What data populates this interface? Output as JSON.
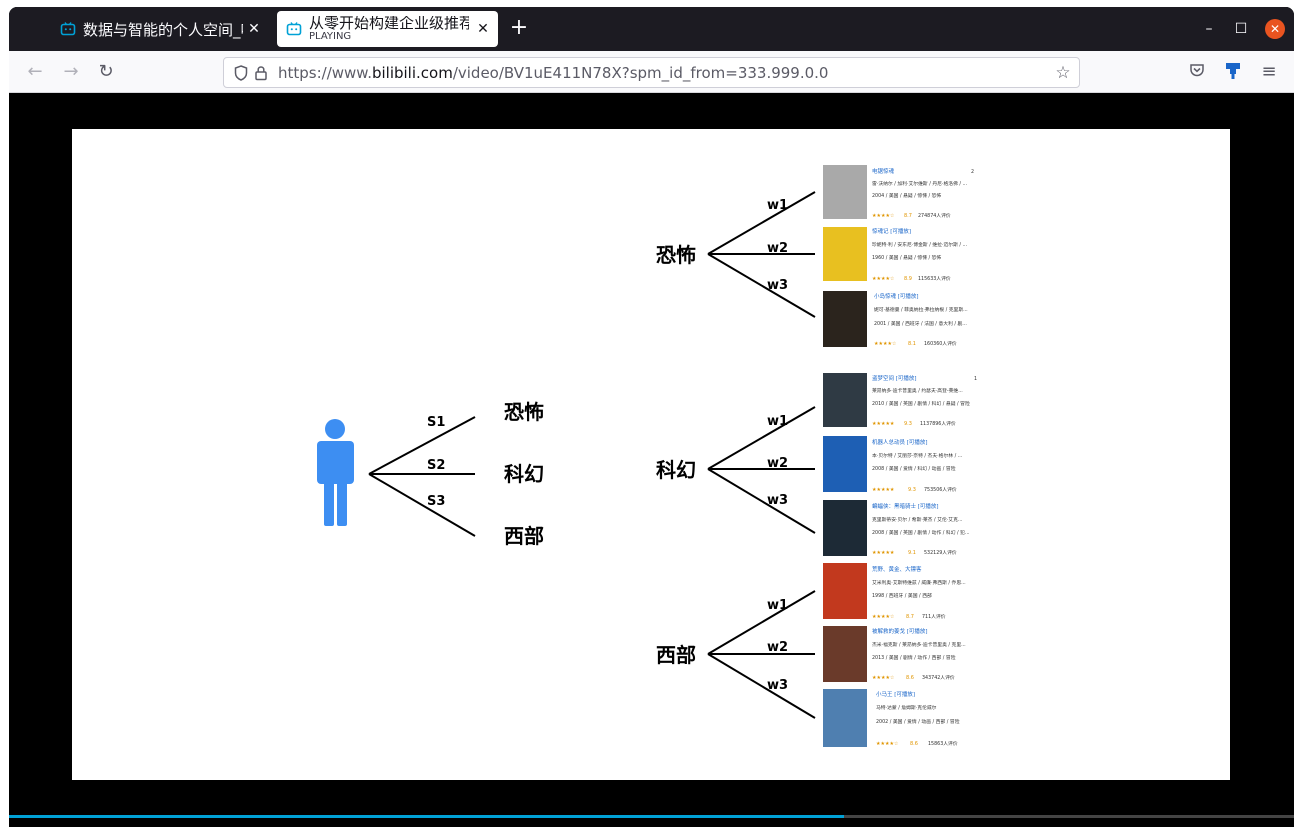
{
  "browser": {
    "tabs": [
      {
        "title": "数据与智能的个人空间_哔",
        "active": false
      },
      {
        "title": "从零开始构建企业级推荐系",
        "subtitle": "PLAYING",
        "active": true
      }
    ],
    "url_prefix": "https://www.",
    "url_host": "bilibili.com",
    "url_path": "/video/BV1uE411N78X?spm_id_from=333.999.0.0",
    "accent": "#00a1d6"
  },
  "player": {
    "progress_fraction": 0.65
  },
  "slide": {
    "left_categories": [
      "恐怖",
      "科幻",
      "西部"
    ],
    "user_weights": [
      "S1",
      "S2",
      "S3"
    ],
    "groups": [
      {
        "category": "恐怖",
        "weights": [
          "w1",
          "w2",
          "w3"
        ],
        "movies": [
          {
            "title": "电锯惊魂",
            "rank": "2",
            "cast": "雷·沃纳尔 / 加利·艾尔维斯 / 丹尼·格洛佛 / ...",
            "info": "2004 / 美国 / 悬疑 / 惊悚 / 恐怖",
            "rating": "8.7",
            "count": "274874人评价",
            "poster": "#a9a9a9"
          },
          {
            "title": "惊魂记 [可播放]",
            "rank": "",
            "cast": "珍妮特·利 / 安东尼·博金斯 / 维拉·迈尔斯 / ...",
            "info": "1960 / 美国 / 悬疑 / 惊悚 / 恐怖",
            "rating": "8.9",
            "count": "115633人评价",
            "poster": "#e8c020"
          },
          {
            "title": "小岛惊魂 [可播放]",
            "rank": "",
            "cast": "妮可·基德曼 / 菲奥纳拉·弗拉纳根 / 克里斯...",
            "info": "2001 / 美国 / 西班牙 / 法国 / 意大利 / 剧...",
            "rating": "8.1",
            "count": "160360人评价",
            "poster": "#2b241d"
          }
        ]
      },
      {
        "category": "科幻",
        "weights": [
          "w1",
          "w2",
          "w3"
        ],
        "movies": [
          {
            "title": "盗梦空间 [可播放]",
            "rank": "1",
            "cast": "莱昂纳多·迪卡普里奥 / 约瑟夫·高登-莱维...",
            "info": "2010 / 美国 / 英国 / 剧情 / 科幻 / 悬疑 / 冒险",
            "rating": "9.3",
            "count": "1137896人评价",
            "poster": "#2f3a44"
          },
          {
            "title": "机器人总动员 [可播放]",
            "rank": "",
            "cast": "本·贝尔特 / 艾丽莎·奈特 / 杰夫·格尔林 / ...",
            "info": "2008 / 美国 / 爱情 / 科幻 / 动画 / 冒险",
            "rating": "9.3",
            "count": "753506人评价",
            "poster": "#1e5fb4"
          },
          {
            "title": "蝙蝠侠：黑暗骑士 [可播放]",
            "rank": "",
            "cast": "克里斯蒂安·贝尔 / 希斯·莱杰 / 艾伦·艾克...",
            "info": "2008 / 美国 / 英国 / 剧情 / 动作 / 科幻 / 犯...",
            "rating": "9.1",
            "count": "532129人评价",
            "poster": "#1d2a36"
          }
        ]
      },
      {
        "category": "西部",
        "weights": [
          "w1",
          "w2",
          "w3"
        ],
        "movies": [
          {
            "title": "荒野、黄金、大镖客",
            "rank": "",
            "cast": "艾米利奥·艾斯特维兹 / 威廉·弗西斯 / 乔思...",
            "info": "1998 / 西班牙 / 美国 / 西部",
            "rating": "8.7",
            "count": "711人评价",
            "poster": "#c2391e"
          },
          {
            "title": "被解救的姜戈 [可播放]",
            "rank": "",
            "cast": "杰米·福克斯 / 莱昂纳多·迪卡普里奥 / 克里...",
            "info": "2013 / 美国 / 剧情 / 动作 / 西部 / 冒险",
            "rating": "8.6",
            "count": "343742人评价",
            "poster": "#6a3a2a"
          },
          {
            "title": "小马王 [可播放]",
            "rank": "",
            "cast": "马特·达蒙 / 詹姆斯·克伦威尔",
            "info": "2002 / 美国 / 爱情 / 动画 / 西部 / 冒险",
            "rating": "8.6",
            "count": "15863人评价",
            "poster": "#4f7fb0"
          }
        ]
      }
    ]
  }
}
